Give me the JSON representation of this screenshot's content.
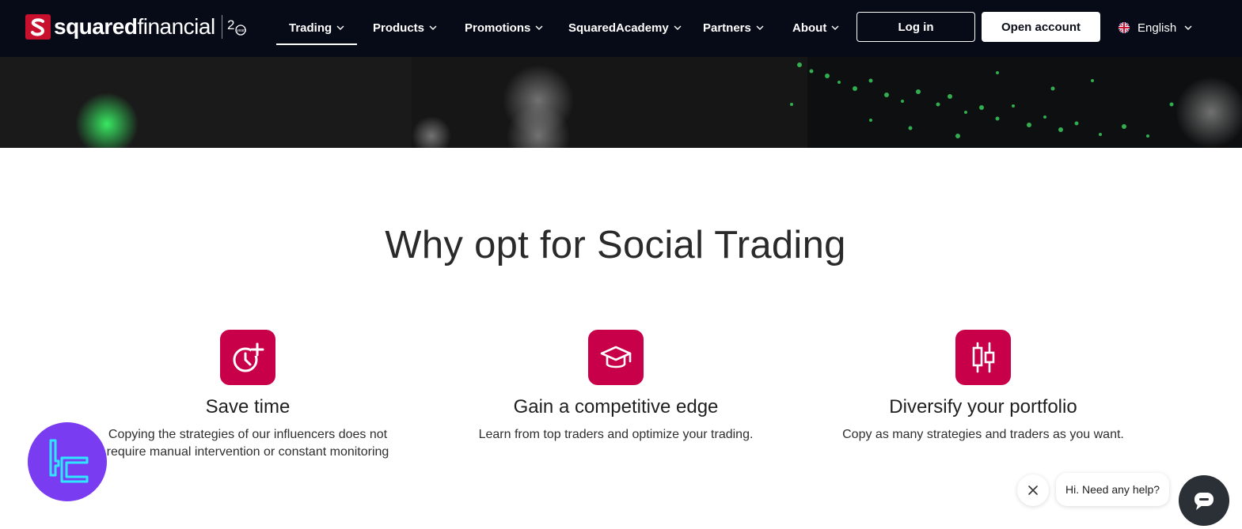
{
  "brand": {
    "name_bold": "squared",
    "name_light": "financial",
    "anniversary": "20 years"
  },
  "nav": {
    "items": [
      {
        "label": "Trading",
        "active": true
      },
      {
        "label": "Products"
      },
      {
        "label": "Promotions"
      },
      {
        "label": "SquaredAcademy"
      },
      {
        "label": "Partners"
      },
      {
        "label": "About"
      }
    ],
    "login_label": "Log in",
    "open_account_label": "Open account",
    "language": "English"
  },
  "main": {
    "title": "Why opt for Social Trading",
    "features": [
      {
        "icon": "clock-plus-icon",
        "title": "Save time",
        "text": "Copying the strategies of our influencers does not require manual intervention or constant monitoring"
      },
      {
        "icon": "graduation-cap-icon",
        "title": "Gain a competitive edge",
        "text": "Learn from top traders and optimize your trading."
      },
      {
        "icon": "candlestick-icon",
        "title": "Diversify your portfolio",
        "text": "Copy as many strategies and traders as you want."
      }
    ]
  },
  "chat": {
    "prompt": "Hi. Need any help?"
  },
  "colors": {
    "nav_bg": "#060b17",
    "accent": "#c8004a",
    "badge": "#7a3cf0",
    "chat_launcher": "#2b3036"
  }
}
